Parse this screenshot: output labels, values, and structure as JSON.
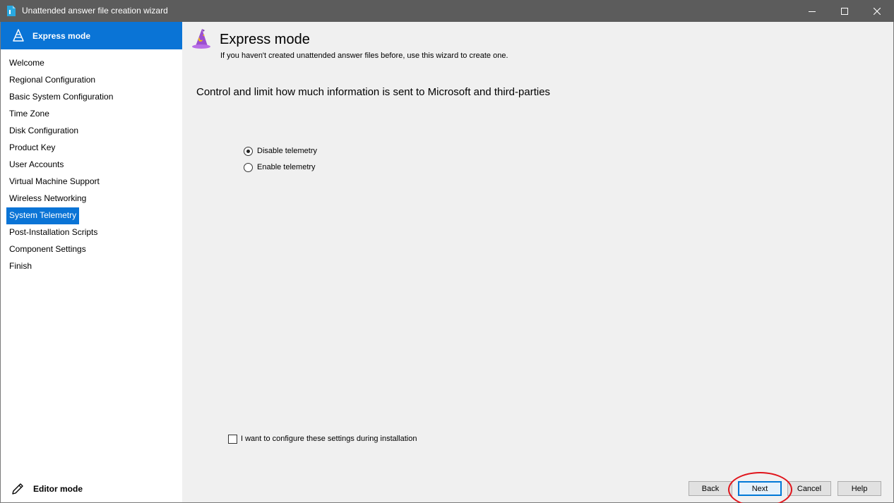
{
  "window": {
    "title": "Unattended answer file creation wizard",
    "controls": [
      "minimize",
      "maximize",
      "close"
    ]
  },
  "sidebar": {
    "header_label": "Express mode",
    "items": [
      {
        "label": "Welcome",
        "active": false
      },
      {
        "label": "Regional Configuration",
        "active": false
      },
      {
        "label": "Basic System Configuration",
        "active": false
      },
      {
        "label": "Time Zone",
        "active": false
      },
      {
        "label": "Disk Configuration",
        "active": false
      },
      {
        "label": "Product Key",
        "active": false
      },
      {
        "label": "User Accounts",
        "active": false
      },
      {
        "label": "Virtual Machine Support",
        "active": false
      },
      {
        "label": "Wireless Networking",
        "active": false
      },
      {
        "label": "System Telemetry",
        "active": true
      },
      {
        "label": "Post-Installation Scripts",
        "active": false
      },
      {
        "label": "Component Settings",
        "active": false
      },
      {
        "label": "Finish",
        "active": false
      }
    ],
    "editor_mode_label": "Editor mode"
  },
  "main": {
    "title": "Express mode",
    "subtitle": "If you haven't created unattended answer files before, use this wizard to create one.",
    "question": "Control and limit how much information is sent to Microsoft and third-parties",
    "options": [
      {
        "label": "Disable telemetry",
        "checked": true
      },
      {
        "label": "Enable telemetry",
        "checked": false
      }
    ],
    "configure_during_install": {
      "label": "I want to configure these settings during installation",
      "checked": false
    }
  },
  "buttons": {
    "back": "Back",
    "next": "Next",
    "cancel": "Cancel",
    "help": "Help"
  },
  "colors": {
    "accent": "#0a74d6",
    "titlebar": "#5c5c5c",
    "annotation": "#e0141b"
  }
}
